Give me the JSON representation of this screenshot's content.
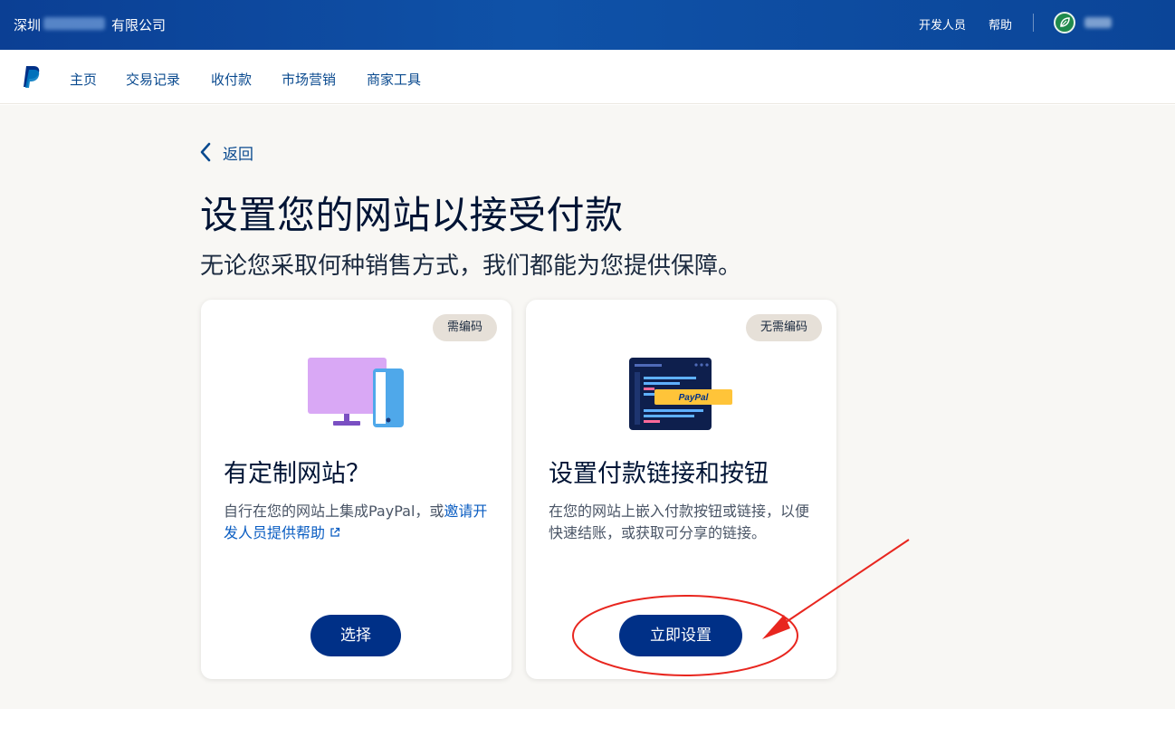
{
  "topbar": {
    "company": "深圳",
    "company_suffix": "有限公司",
    "developer": "开发人员",
    "help": "帮助"
  },
  "nav": {
    "items": [
      "主页",
      "交易记录",
      "收付款",
      "市场营销",
      "商家工具"
    ]
  },
  "page": {
    "back": "返回",
    "title": "设置您的网站以接受付款",
    "subtitle": "无论您采取何种销售方式，我们都能为您提供保障。"
  },
  "cards": [
    {
      "badge": "需编码",
      "title": "有定制网站？",
      "desc_prefix": "自行在您的网站上集成PayPal，或",
      "desc_link": "邀请开发人员提供帮助",
      "button": "选择"
    },
    {
      "badge": "无需编码",
      "title": "设置付款链接和按钮",
      "desc": "在您的网站上嵌入付款按钮或链接，以便快速结账，或获取可分享的链接。",
      "button": "立即设置",
      "illus_label": "PayPal"
    }
  ],
  "colors": {
    "topbar": "#0b3f94",
    "nav_text": "#0a4a8f",
    "primary_button": "#003087",
    "badge_bg": "#e6e0d8",
    "annotation": "#e8261f"
  }
}
